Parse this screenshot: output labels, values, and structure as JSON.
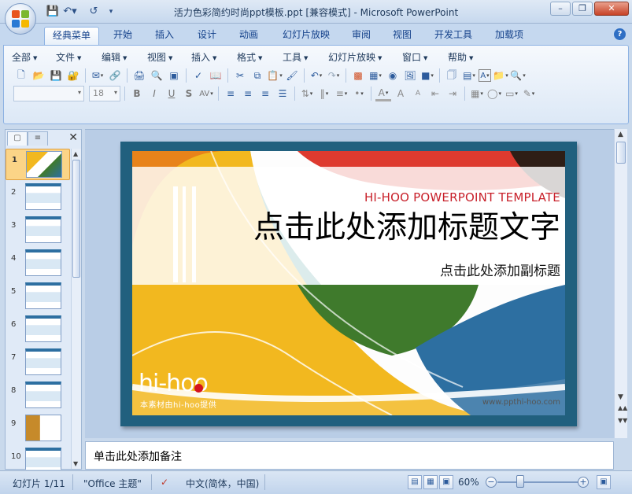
{
  "window": {
    "title": "活力色彩简约时尚ppt模板.ppt [兼容模式] - Microsoft PowerPoint",
    "minimize_icon": "minimize-icon",
    "maximize_icon": "restore-icon",
    "close_icon": "close-icon"
  },
  "quick_access": [
    "save-icon",
    "undo-icon",
    "redo-icon",
    "customize-icon"
  ],
  "ribbon_tabs": [
    "经典菜单",
    "开始",
    "插入",
    "设计",
    "动画",
    "幻灯片放映",
    "审阅",
    "视图",
    "开发工具",
    "加载项"
  ],
  "active_tab": "经典菜单",
  "classic_menu": [
    "全部",
    "文件",
    "编辑",
    "视图",
    "插入",
    "格式",
    "工具",
    "幻灯片放映",
    "窗口",
    "帮助"
  ],
  "toolbar": {
    "font_name": "",
    "font_size": "18",
    "text_color_label": "A",
    "shape_text_label": "A"
  },
  "slides_panel": {
    "tab_slides_icon": "slides-tab-icon",
    "tab_outline_icon": "outline-tab-icon",
    "close_icon": "close-icon",
    "slide_numbers": [
      "1",
      "2",
      "3",
      "4",
      "5",
      "6",
      "7",
      "8",
      "9",
      "10"
    ],
    "selected": "1"
  },
  "slide": {
    "english_title": "HI-HOO POWERPOINT TEMPLATE",
    "title_placeholder": "点击此处添加标题文字",
    "subtitle_placeholder": "点击此处添加副标题",
    "logo_text": "hi-hoo",
    "logo_tagline": "本素材由hi-hoo提供",
    "url": "www.ppthi-hoo.com",
    "colors": {
      "frame": "#21607e",
      "yellow": "#f2b81f",
      "orange": "#e8831a",
      "green": "#3f7a2c",
      "blue": "#2d6fa1",
      "red": "#de3a2f",
      "teal": "#2a8a8a",
      "dark": "#2e1e16",
      "accent_red_text": "#c8202a"
    }
  },
  "notes": {
    "placeholder": "单击此处添加备注"
  },
  "status": {
    "slide_info": "幻灯片 1/11",
    "theme": "\"Office 主题\"",
    "language": "中文(简体，中国)",
    "zoom": "60%"
  }
}
